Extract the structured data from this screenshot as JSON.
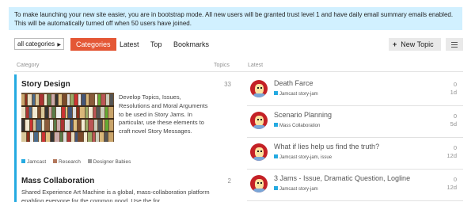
{
  "banner": {
    "line1": "To make launching your new site easier, you are in bootstrap mode. All new users will be granted trust level 1 and have daily email summary emails enabled.",
    "line2": "This will be automatically turned off when 50 users have joined."
  },
  "nav": {
    "category_select": "all categories",
    "items": [
      "Categories",
      "Latest",
      "Top",
      "Bookmarks"
    ],
    "active": "Categories",
    "new_topic": "New Topic"
  },
  "columns": {
    "category": "Category",
    "topics": "Topics",
    "latest": "Latest"
  },
  "categories": [
    {
      "name": "Story Design",
      "topics": "33",
      "color": "#25aae1",
      "description": "Develop Topics, Issues, Resolutions and Moral Arguments to be used in Story Jams. In particular, use these elements to craft novel Story Messages.",
      "subcategories": [
        {
          "name": "Jamcast",
          "color": "#25aae1"
        },
        {
          "name": "Research",
          "color": "#b3775b"
        },
        {
          "name": "Designer Babies",
          "color": "#9e9e9e"
        }
      ]
    },
    {
      "name": "Mass Collaboration",
      "topics": "2",
      "color": "#25aae1",
      "description": "Shared Experience Art Machine is a global, mass-collaboration platform enabling everyone for the common good. Use the for..."
    }
  ],
  "latest": [
    {
      "title": "Death Farce",
      "category": "Jamcast",
      "tags": "story-jam",
      "replies": "0",
      "age": "1d"
    },
    {
      "title": "Scenario Planning",
      "category": "Mass Collaboration",
      "tags": "",
      "replies": "0",
      "age": "5d"
    },
    {
      "title": "What if lies help us find the truth?",
      "category": "Jamcast",
      "tags": "story-jam, issue",
      "replies": "0",
      "age": "12d"
    },
    {
      "title": "3 Jams - Issue, Dramatic Question, Logline",
      "category": "Jamcast",
      "tags": "story-jam",
      "replies": "0",
      "age": "12d"
    }
  ]
}
